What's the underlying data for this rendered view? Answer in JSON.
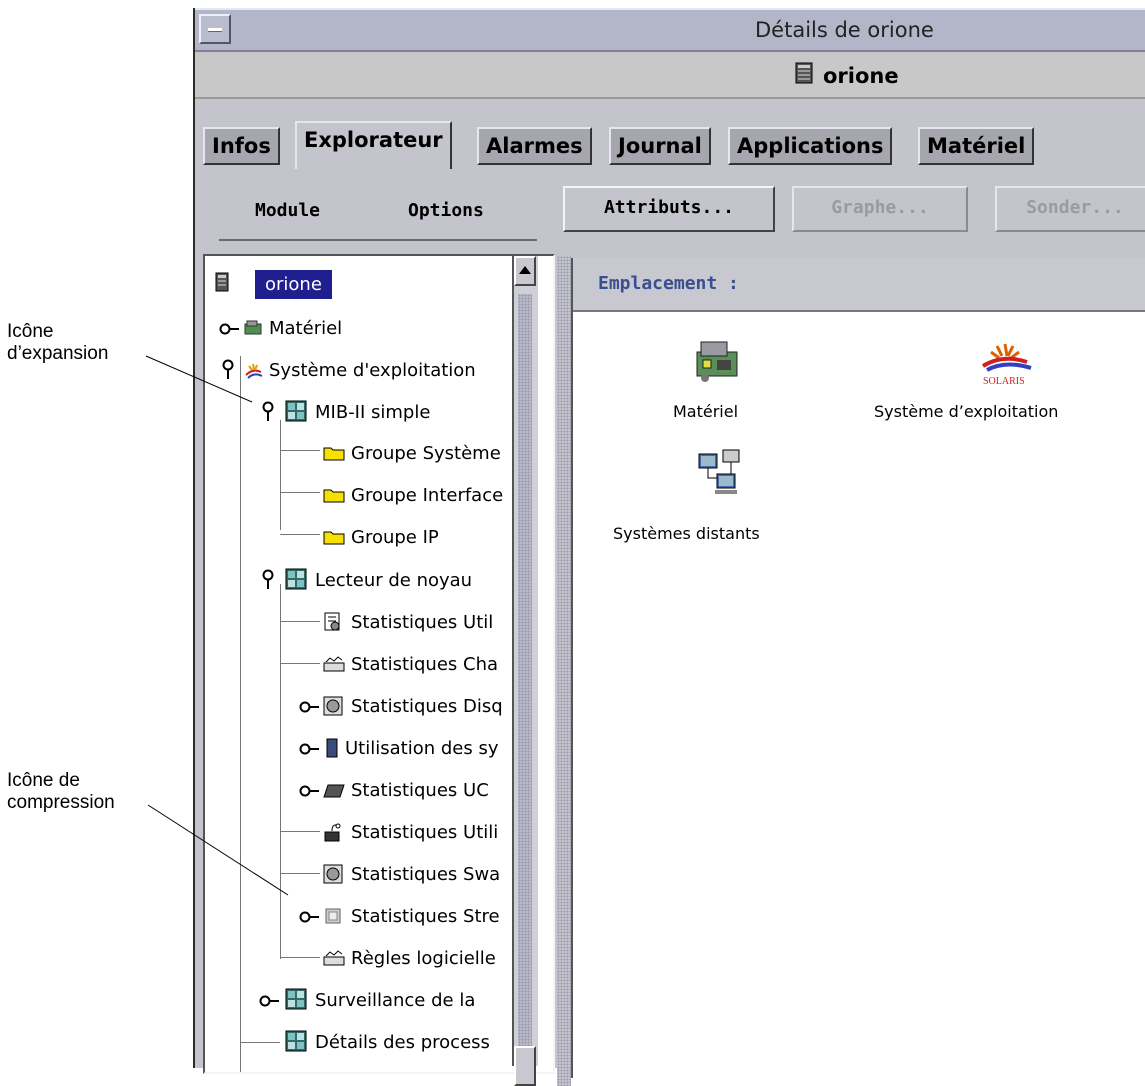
{
  "annotations": {
    "expand": [
      "Icône",
      "d’expansion"
    ],
    "collapse": [
      "Icône de",
      "compression"
    ]
  },
  "window": {
    "title": "Détails de orione",
    "host": "orione"
  },
  "tabs": [
    "Infos",
    "Explorateur",
    "Alarmes",
    "Journal",
    "Applications",
    "Matériel"
  ],
  "active_tab": "Explorateur",
  "toolbar": {
    "menus": [
      "Module",
      "Options"
    ],
    "attributes": "Attributs...",
    "graph": "Graphe...",
    "probe": "Sonder..."
  },
  "tree": {
    "root": "orione",
    "items": [
      "Matériel",
      "Système d'exploitation",
      "MIB-II simple",
      "Groupe Système",
      "Groupe Interface",
      "Groupe IP",
      "Lecteur de noyau",
      "Statistiques Util",
      "Statistiques Cha",
      "Statistiques Disq",
      "Utilisation des sy",
      "Statistiques UC",
      "Statistiques Utili",
      "Statistiques Swa",
      "Statistiques Stre",
      "Règles logicielle",
      "Surveillance de la",
      "Détails des process"
    ]
  },
  "content": {
    "location_label": "Emplacement :",
    "icons": [
      "Matériel",
      "Système d’exploitation",
      "Systèmes distants"
    ],
    "solaris_logo": "SOLARIS"
  }
}
